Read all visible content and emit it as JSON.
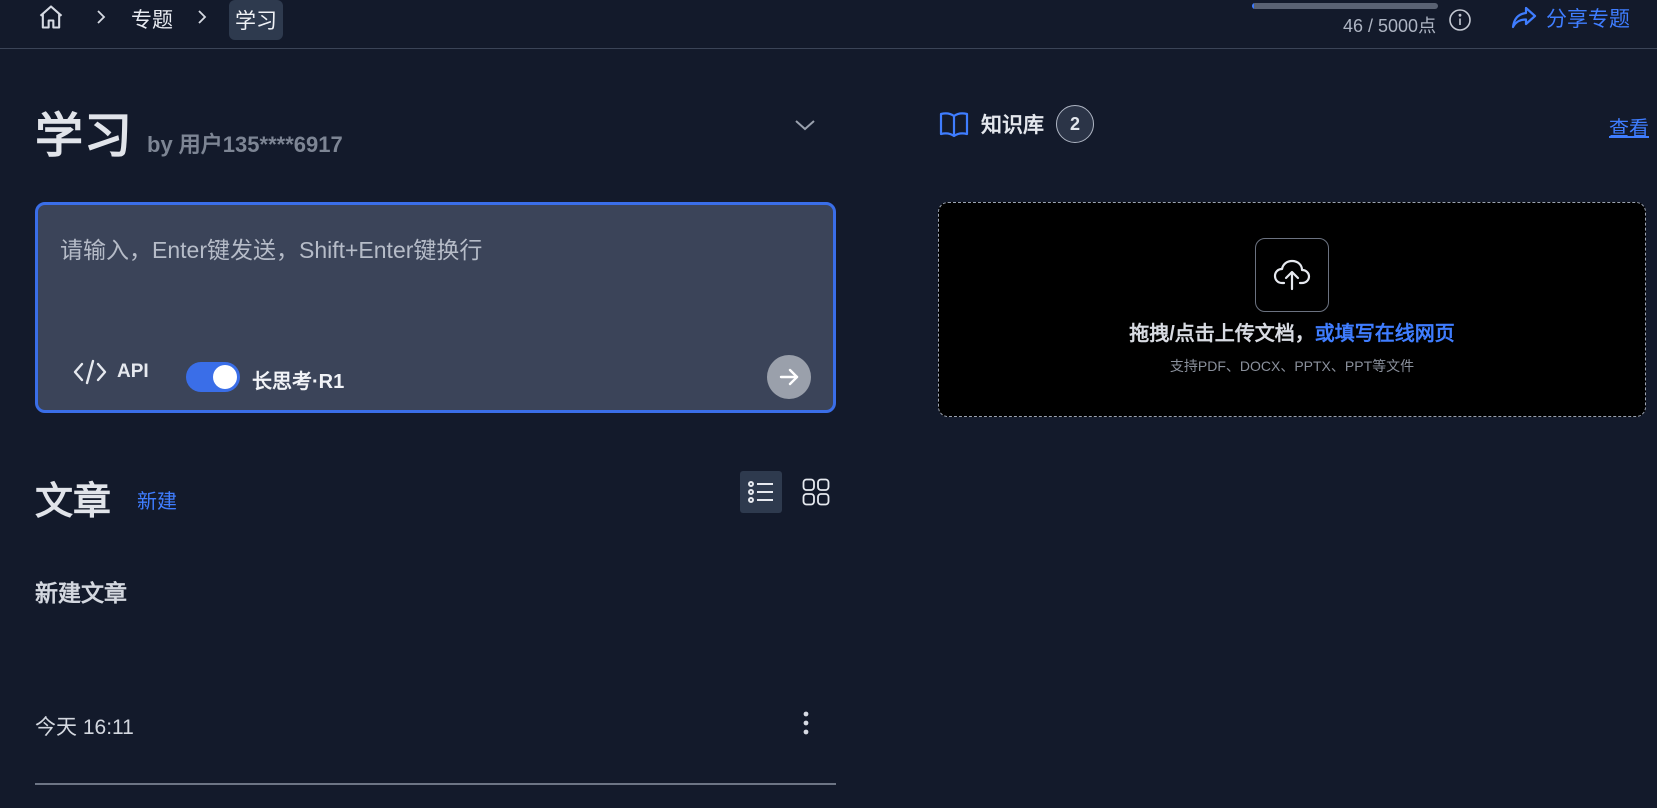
{
  "breadcrumb": {
    "items": [
      "专题"
    ],
    "current": "学习"
  },
  "quota": {
    "text": "46 / 5000点",
    "used": 46,
    "total": 5000
  },
  "header": {
    "share_label": "分享专题"
  },
  "topic": {
    "title": "学习",
    "author": "by 用户135****6917"
  },
  "composer": {
    "placeholder": "请输入，Enter键发送，Shift+Enter键换行",
    "api_label": "API",
    "toggle_label": "长思考·R1",
    "toggle_on": true
  },
  "articles": {
    "section_title": "文章",
    "new_label": "新建",
    "view_mode": "list",
    "items": [
      {
        "title": "新建文章",
        "date": "今天 16:11"
      }
    ]
  },
  "knowledge_base": {
    "label": "知识库",
    "count": "2",
    "view_label": "查看",
    "upload_text": "拖拽/点击上传文档，",
    "upload_link": "或填写在线网页",
    "upload_hint": "支持PDF、DOCX、PPTX、PPT等文件"
  },
  "colors": {
    "background": "#131a2b",
    "accent": "#3f7dff",
    "input_bg": "#3b4459"
  }
}
